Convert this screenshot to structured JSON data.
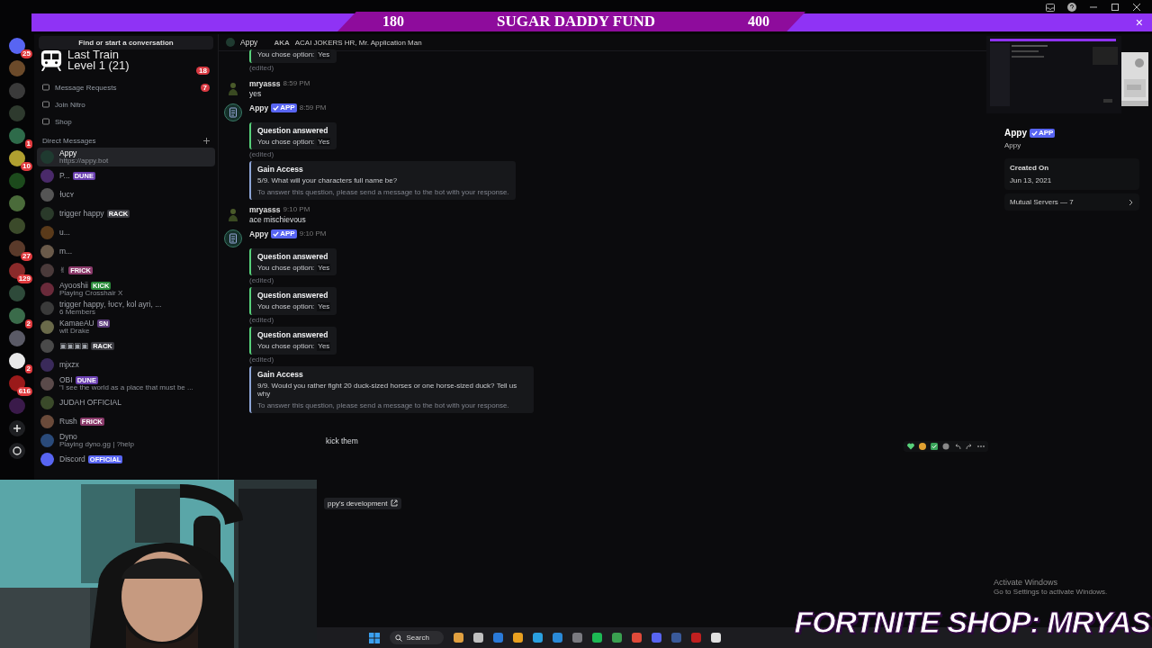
{
  "goal_bar": {
    "current": "180",
    "title": "SUGAR DADDY FUND",
    "target": "400",
    "close": "×"
  },
  "overlay_level": {
    "title": "Last Train",
    "level": "Level 1 (21)"
  },
  "servers": [
    {
      "color": "#5865f2",
      "count": "25"
    },
    {
      "color": "#6b4a2a"
    },
    {
      "color": "#3a3a3a"
    },
    {
      "color": "#2e3a2e"
    },
    {
      "color": "#2e6b4a",
      "count": "1"
    },
    {
      "color": "#b0a030",
      "count": "10"
    },
    {
      "color": "#1c4a1c"
    },
    {
      "color": "#4a6b3a"
    },
    {
      "color": "#3b4a2a"
    },
    {
      "color": "#5a3a2a",
      "count": "27"
    },
    {
      "color": "#8a2a2a",
      "count": "129"
    },
    {
      "color": "#2e4a3a"
    },
    {
      "color": "#3a6b4a",
      "count": "2"
    },
    {
      "color": "#5a5a66"
    },
    {
      "color": "#e8e8e8",
      "count": "2"
    },
    {
      "color": "#9a1a1a",
      "count": "616"
    },
    {
      "color": "#3a1a4a"
    }
  ],
  "search_button": "Find or start a conversation",
  "nav": [
    {
      "count": "18"
    },
    {
      "label": "Message Requests",
      "count": "7"
    },
    {
      "label": "Join Nitro"
    },
    {
      "label": "Shop"
    }
  ],
  "dm_heading": "Direct Messages",
  "dms": [
    {
      "name": "Appy",
      "subtitle": "https://appy.bot",
      "selected": true,
      "color": "#1f3a30"
    },
    {
      "name": "P...",
      "tag": {
        "text": "DUNE",
        "color": "#6a3fb0"
      },
      "selected": false,
      "color": "#4a2a6a"
    },
    {
      "name": "ɫᴜᴄʏ",
      "selected": false,
      "color": "#555555"
    },
    {
      "name": "trigger happy",
      "tag": {
        "text": "RACK",
        "color": "#3a3a40"
      },
      "selected": false,
      "color": "#2a3a2a"
    },
    {
      "name": "u...",
      "selected": false,
      "color": "#5a3a1a"
    },
    {
      "name": "m...",
      "selected": false,
      "color": "#6a5a4a"
    },
    {
      "name": "✌",
      "tag": {
        "text": "FRICK",
        "color": "#8a3a6a"
      },
      "selected": false,
      "color": "#4a3a3a"
    },
    {
      "name": "Ayooshii",
      "tag": {
        "text": "KICK",
        "color": "#2a8a3a"
      },
      "subtitle": "Playing Crosshair X",
      "selected": false,
      "color": "#6a2a3a"
    },
    {
      "name": "trigger happy, ɫᴜᴄʏ, kol ayri, ...",
      "subtitle": "6 Members",
      "selected": false,
      "color": "#3a3a3a"
    },
    {
      "name": "KamaeAU",
      "tag": {
        "text": "SN",
        "color": "#5a3a7a"
      },
      "subtitle": "wit Drake",
      "selected": false,
      "color": "#6a6a4a"
    },
    {
      "name": "▣▣▣▣",
      "tag": {
        "text": "RACK",
        "color": "#3a3a40"
      },
      "selected": false,
      "color": "#4a4a4a"
    },
    {
      "name": "mjxzx",
      "selected": false,
      "color": "#3a2a5a"
    },
    {
      "name": "OBI",
      "tag": {
        "text": "DUNE",
        "color": "#6a3fb0"
      },
      "subtitle": "\"I see the world as a place that must be ...",
      "selected": false,
      "color": "#5a4a4a"
    },
    {
      "name": "JUDAH OFFICIAL",
      "selected": false,
      "color": "#3a4a2a"
    },
    {
      "name": "Rush",
      "tag": {
        "text": "FRICK",
        "color": "#8a3a6a"
      },
      "selected": false,
      "color": "#6a4a3a"
    },
    {
      "name": "Dyno",
      "subtitle": "Playing dyno.gg | ?help",
      "selected": false,
      "color": "#2a4a7a"
    },
    {
      "name": "Discord",
      "tag": {
        "text": "OFFICIAL",
        "color": "#5865f2"
      },
      "selected": false,
      "color": "#5865f2"
    }
  ],
  "chat_header": {
    "name": "Appy",
    "aka_label": "AKA",
    "aka": "ACAI JOKERS HR, Mr. Application Man"
  },
  "messages": [
    {
      "kind": "embed",
      "color": "#57d17a",
      "text": "You chose option:",
      "value": "Yes"
    },
    {
      "kind": "edited",
      "text": "(edited)"
    },
    {
      "kind": "message",
      "author": "mryasss",
      "time": "8:59 PM",
      "text": "yes",
      "bot": false
    },
    {
      "kind": "message",
      "author": "Appy",
      "tag": "APP",
      "time": "8:59 PM",
      "bot": true
    },
    {
      "kind": "embed",
      "color": "#57d17a",
      "title": "Question answered",
      "text": "You chose option:",
      "value": "Yes"
    },
    {
      "kind": "edited",
      "text": "(edited)"
    },
    {
      "kind": "embed",
      "color": "#8ea6d8",
      "title": "Gain Access",
      "text": "5/9. What will your characters full name be?",
      "note": "To answer this question, please send a message to the bot with your response."
    },
    {
      "kind": "message",
      "author": "mryasss",
      "time": "9:10 PM",
      "text": "ace mischievous",
      "bot": false
    },
    {
      "kind": "message",
      "author": "Appy",
      "tag": "APP",
      "time": "9:10 PM",
      "bot": true
    },
    {
      "kind": "embed",
      "color": "#57d17a",
      "title": "Question answered",
      "text": "You chose option:",
      "value": "Yes"
    },
    {
      "kind": "edited",
      "text": "(edited)"
    },
    {
      "kind": "embed",
      "color": "#57d17a",
      "title": "Question answered",
      "text": "You chose option:",
      "value": "Yes"
    },
    {
      "kind": "edited",
      "text": "(edited)"
    },
    {
      "kind": "embed",
      "color": "#57d17a",
      "title": "Question answered",
      "text": "You chose option:",
      "value": "Yes"
    },
    {
      "kind": "edited",
      "text": "(edited)"
    },
    {
      "kind": "embed",
      "color": "#8ea6d8",
      "title": "Gain Access",
      "text": "9/9. Would you rather fight 20 duck-sized horses or one horse-sized duck? Tell us why",
      "note": "To answer this question, please send a message to the bot with your response."
    },
    {
      "kind": "text",
      "text": "kick them"
    },
    {
      "kind": "link",
      "text": "ppy's development"
    }
  ],
  "profile": {
    "name": "Appy",
    "tag": "APP",
    "username": "Appy",
    "created_label": "Created On",
    "created": "Jun 13, 2021",
    "mutual": "Mutual Servers — 7"
  },
  "activation": {
    "title": "Activate Windows",
    "text": "Go to Settings to activate Windows."
  },
  "taskbar": {
    "search": "Search",
    "apps": [
      {
        "color": "#e0a040"
      },
      {
        "color": "#c0c0c0"
      },
      {
        "color": "#2a7ad8"
      },
      {
        "color": "#e8a020"
      },
      {
        "color": "#2aa0e0"
      },
      {
        "color": "#2a8ad8"
      },
      {
        "color": "#7a7a80"
      },
      {
        "color": "#1db954"
      },
      {
        "color": "#3aa050"
      },
      {
        "color": "#e04a3a"
      },
      {
        "color": "#5865f2"
      },
      {
        "color": "#3a5a9a"
      },
      {
        "color": "#c02020"
      },
      {
        "color": "#e0e0e0"
      }
    ]
  },
  "promo": "FORTNITE SHOP: MRYAS"
}
